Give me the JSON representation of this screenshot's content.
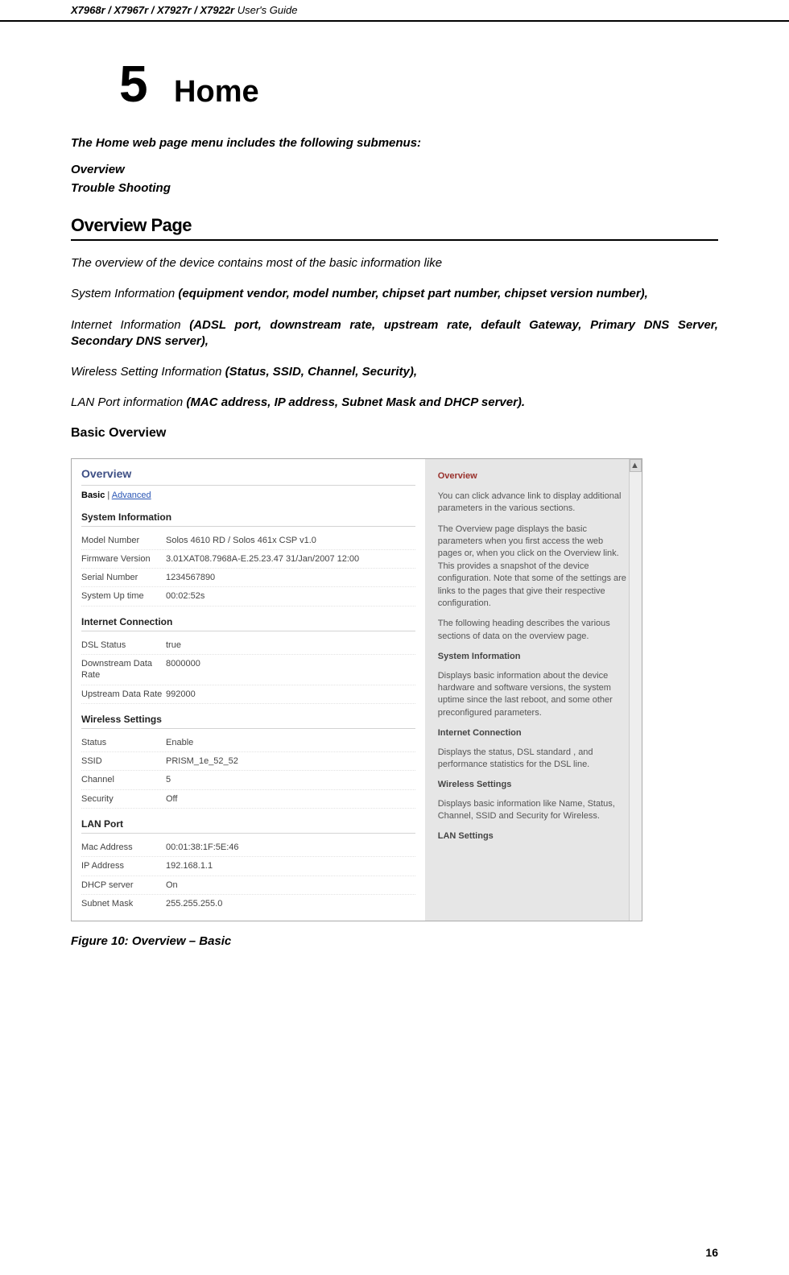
{
  "header": {
    "left_models": "X7968r / X7967r / X7927r / X7922r",
    "left_suffix": " User's Guide"
  },
  "chapter": {
    "number": "5",
    "title": "Home"
  },
  "intro": "The Home web page menu includes the following submenus:",
  "submenus": {
    "item1": "Overview",
    "item2": "Trouble Shooting"
  },
  "overviewPage": {
    "heading": "Overview Page",
    "p1": "The overview of the device contains most of the basic information like",
    "p2_lead": "System Information ",
    "p2_bold": "(equipment vendor, model number, chipset part number, chipset version number),",
    "p3_lead": "Internet Information ",
    "p3_bold": "(ADSL port, downstream rate, upstream rate, default Gateway, Primary DNS Server, Secondary DNS server),",
    "p4_lead": "Wireless Setting Information ",
    "p4_bold": "(Status, SSID, Channel, Security),",
    "p5_lead": "LAN Port information ",
    "p5_bold": "(MAC address, IP address, Subnet Mask and DHCP server).",
    "subsection": "Basic Overview"
  },
  "screenshot": {
    "title": "Overview",
    "tabs": {
      "basic": "Basic",
      "sep": " | ",
      "advanced": "Advanced"
    },
    "groups": {
      "sys": {
        "title": "System Information",
        "rows": {
          "model_k": "Model Number",
          "model_v": "Solos 4610 RD / Solos 461x CSP v1.0",
          "fw_k": "Firmware Version",
          "fw_v": "3.01XAT08.7968A-E.25.23.47 31/Jan/2007 12:00",
          "serial_k": "Serial Number",
          "serial_v": "1234567890",
          "uptime_k": "System Up time",
          "uptime_v": "00:02:52s"
        }
      },
      "net": {
        "title": "Internet Connection",
        "rows": {
          "dsl_k": "DSL Status",
          "dsl_v": "true",
          "down_k": "Downstream Data Rate",
          "down_v": "8000000",
          "up_k": "Upstream Data Rate",
          "up_v": "992000"
        }
      },
      "wifi": {
        "title": "Wireless Settings",
        "rows": {
          "status_k": "Status",
          "status_v": "Enable",
          "ssid_k": "SSID",
          "ssid_v": "PRISM_1e_52_52",
          "chan_k": "Channel",
          "chan_v": "5",
          "sec_k": "Security",
          "sec_v": "Off"
        }
      },
      "lan": {
        "title": "LAN Port",
        "rows": {
          "mac_k": "Mac Address",
          "mac_v": "00:01:38:1F:5E:46",
          "ip_k": "IP Address",
          "ip_v": "192.168.1.1",
          "dhcp_k": "DHCP server",
          "dhcp_v": "On",
          "mask_k": "Subnet Mask",
          "mask_v": "255.255.255.0"
        }
      }
    },
    "help": {
      "title": "Overview",
      "p1": "You can click advance link to display additional parameters in the various sections.",
      "p2": "The Overview page displays the basic parameters when you first access the web pages or, when you click on the Overview link. This provides a snapshot of the device configuration. Note that some of the settings are links to the pages that give their respective configuration.",
      "p3": "The following heading describes the various sections of data on the overview page.",
      "h_sys": "System Information",
      "p_sys": "Displays basic information about the device hardware and software versions, the system uptime since the last reboot, and some other preconfigured parameters.",
      "h_net": "Internet Connection",
      "p_net": "Displays the status, DSL standard , and performance statistics for the DSL line.",
      "h_wifi": "Wireless Settings",
      "p_wifi": "Displays basic information like Name, Status, Channel, SSID and Security for Wireless.",
      "h_lan": "LAN Settings"
    }
  },
  "figure": "Figure 10: Overview – Basic",
  "pageNumber": "16"
}
